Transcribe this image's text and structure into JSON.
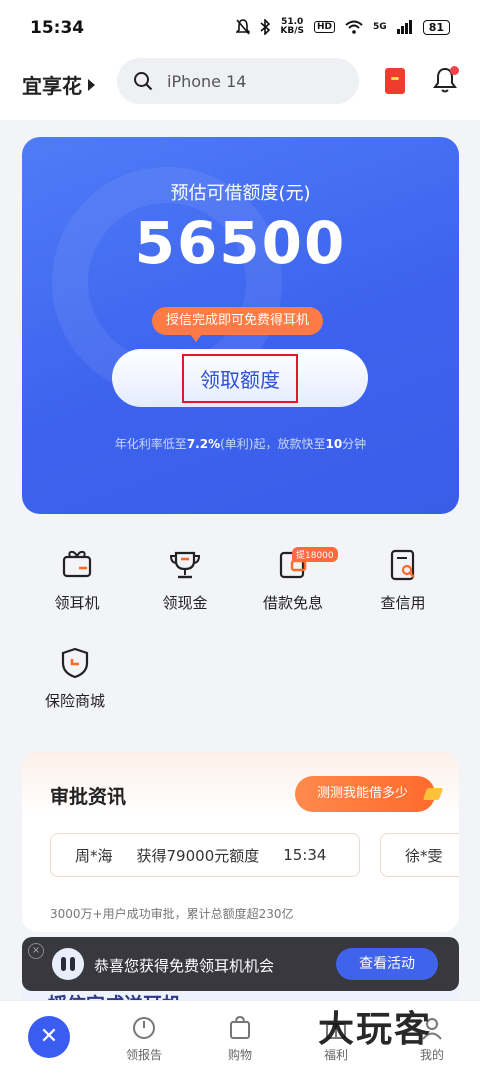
{
  "status_bar": {
    "time": "15:34",
    "net_speed_value": "51.0",
    "net_speed_unit": "KB/S",
    "hd": "HD",
    "signal": "5G",
    "battery": "81"
  },
  "header": {
    "brand": "宜享花",
    "search_placeholder": "iPhone 14"
  },
  "credit_card": {
    "title": "预估可借额度(元)",
    "amount": "56500",
    "tip": "授信完成即可免费得耳机",
    "button": "领取额度",
    "note_prefix": "年化利率低至",
    "note_rate": "7.2%",
    "note_middle": "(单利)起，放款快至",
    "note_time": "10",
    "note_suffix": "分钟"
  },
  "quick_actions": [
    {
      "label": "领耳机",
      "icon": "gift-icon"
    },
    {
      "label": "领现金",
      "icon": "trophy-icon"
    },
    {
      "label": "借款免息",
      "icon": "wallet-icon",
      "badge": "提18000"
    },
    {
      "label": "查信用",
      "icon": "credit-report-icon"
    },
    {
      "label": "保险商城",
      "icon": "shield-icon"
    }
  ],
  "approval_news": {
    "title": "审批资讯",
    "button": "测测我能借多少",
    "row1": {
      "name": "周*海",
      "text": "获得79000元额度",
      "time": "15:34"
    },
    "row2": {
      "name": "徐*雯"
    },
    "footer": "3000万+用户成功审批，累计总额度超230亿"
  },
  "next_card_title": "授信完成送耳机",
  "toast": {
    "message": "恭喜您获得免费领耳机机会",
    "button": "查看活动"
  },
  "tabs": [
    {
      "label": "领报告"
    },
    {
      "label": "购物"
    },
    {
      "label": "福利"
    },
    {
      "label": "我的"
    }
  ],
  "watermark": "大玩客",
  "colors": {
    "primary": "#3d63ee",
    "accent": "#ff7a45",
    "highlight_box": "#e0182b"
  }
}
